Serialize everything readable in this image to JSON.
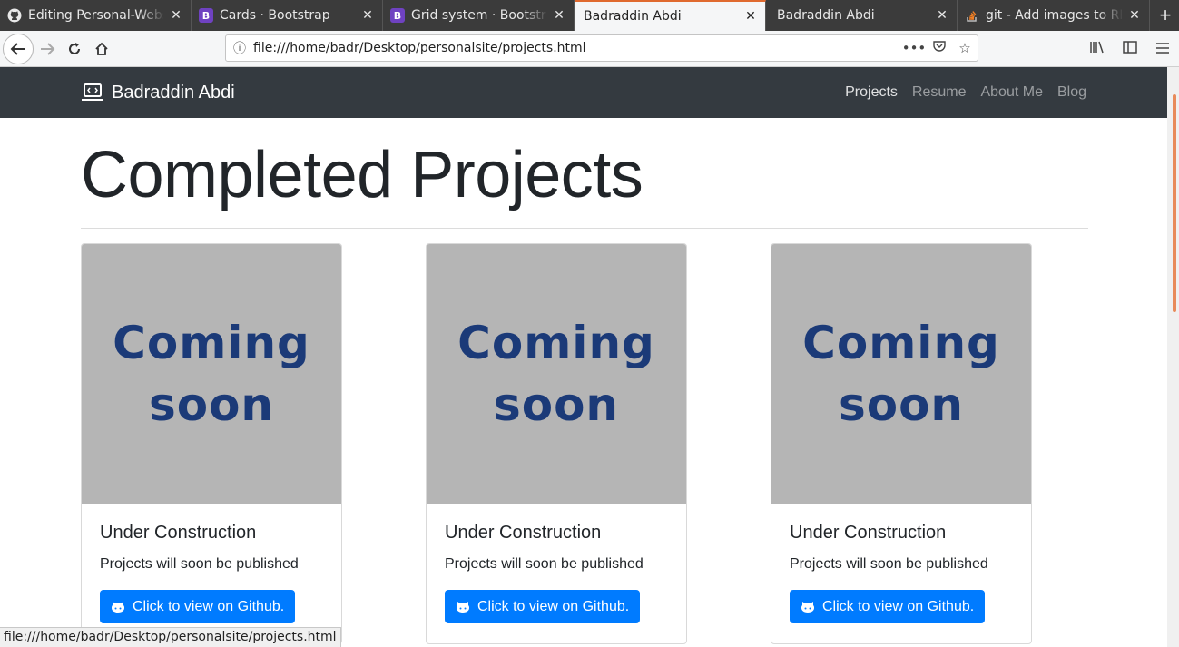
{
  "browser": {
    "tabs": [
      {
        "title": "Editing Personal-Webs",
        "icon": "github-icon",
        "active": false
      },
      {
        "title": "Cards · Bootstrap",
        "icon": "bootstrap-icon",
        "active": false
      },
      {
        "title": "Grid system · Bootstra",
        "icon": "bootstrap-icon",
        "active": false
      },
      {
        "title": "Badraddin Abdi",
        "icon": "",
        "active": true
      },
      {
        "title": "Badraddin Abdi",
        "icon": "",
        "active": false
      },
      {
        "title": "git - Add images to RE",
        "icon": "stackoverflow-icon",
        "active": false
      }
    ],
    "url": "file:///home/badr/Desktop/personalsite/projects.html",
    "status": "file:///home/badr/Desktop/personalsite/projects.html"
  },
  "site": {
    "brand": "Badraddin Abdi",
    "nav": [
      {
        "label": "Projects",
        "active": true
      },
      {
        "label": "Resume",
        "active": false
      },
      {
        "label": "About Me",
        "active": false
      },
      {
        "label": "Blog",
        "active": false
      }
    ],
    "heading": "Completed Projects",
    "cards": [
      {
        "image_line1": "Coming",
        "image_line2": "soon",
        "title": "Under Construction",
        "text": "Projects will soon be published",
        "button": "Click to view on Github."
      },
      {
        "image_line1": "Coming",
        "image_line2": "soon",
        "title": "Under Construction",
        "text": "Projects will soon be published",
        "button": "Click to view on Github."
      },
      {
        "image_line1": "Coming",
        "image_line2": "soon",
        "title": "Under Construction",
        "text": "Projects will soon be published",
        "button": "Click to view on Github."
      }
    ]
  },
  "colors": {
    "navbar": "#343a40",
    "primary_button": "#007bff",
    "image_placeholder": "#b5b5b5",
    "placeholder_text": "#1b3a78"
  }
}
